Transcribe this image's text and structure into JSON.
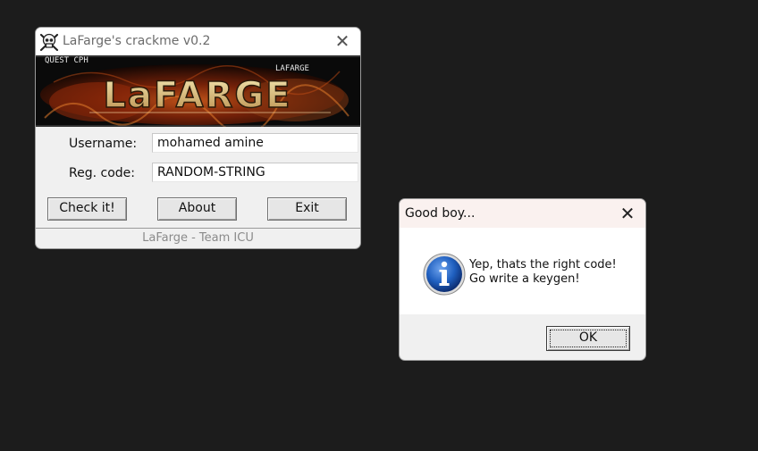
{
  "crackme": {
    "title": "LaFarge's crackme v0.2",
    "banner": {
      "corner_left": "QUEST CPH",
      "corner_right": "LAFARGE",
      "logo_text": "LaFARGE"
    },
    "username_label": "Username:",
    "username_value": "mohamed amine",
    "regcode_label": "Reg. code:",
    "regcode_value": "RANDOM-STRING",
    "check_button": "Check it!",
    "about_button": "About",
    "exit_button": "Exit",
    "status_text": "LaFarge - Team ICU",
    "close_glyph": "✕"
  },
  "msgbox": {
    "title": "Good boy...",
    "message_line1": "Yep, thats the right code!",
    "message_line2": "Go write a keygen!",
    "ok_button": "OK",
    "icon": "info-icon",
    "close_glyph": "✕"
  },
  "colors": {
    "desktop": "#1c1c1c",
    "window_bg": "#f0f0f0",
    "banner_bg": "#0b0b0b",
    "info_blue": "#1f5fbf"
  }
}
